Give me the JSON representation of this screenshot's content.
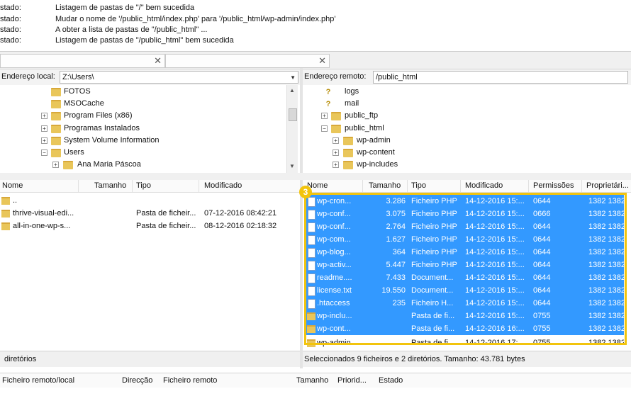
{
  "log": [
    {
      "status": "stado:",
      "message": "Listagem de pastas de \"/\" bem sucedida"
    },
    {
      "status": "stado:",
      "message": "Mudar o nome de '/public_html/index.php' para '/public_html/wp-admin/index.php'"
    },
    {
      "status": "stado:",
      "message": "A obter a lista de pastas de \"/public_html\" ..."
    },
    {
      "status": "stado:",
      "message": "Listagem de pastas de \"/public_html\" bem sucedida"
    }
  ],
  "local": {
    "address_label": "Endereço local:",
    "address_value": "Z:\\Users\\",
    "tree": [
      {
        "label": "FOTOS",
        "expander": ""
      },
      {
        "label": "MSOCache",
        "expander": ""
      },
      {
        "label": "Program Files (x86)",
        "expander": "+"
      },
      {
        "label": "Programas Instalados",
        "expander": "+"
      },
      {
        "label": "System Volume Information",
        "expander": "+"
      },
      {
        "label": "Users",
        "expander": "−"
      },
      {
        "label": "Ana Maria Páscoa",
        "expander": "+"
      }
    ],
    "columns": [
      "Nome",
      "Tamanho",
      "Tipo",
      "Modificado"
    ],
    "files": [
      {
        "name": "..",
        "size": "",
        "type": "",
        "modified": ""
      },
      {
        "name": "thrive-visual-edi...",
        "size": "",
        "type": "Pasta de ficheir...",
        "modified": "07-12-2016 08:42:21"
      },
      {
        "name": "all-in-one-wp-s...",
        "size": "",
        "type": "Pasta de ficheir...",
        "modified": "08-12-2016 02:18:32"
      }
    ],
    "status": "diretórios"
  },
  "remote": {
    "address_label": "Endereço remoto:",
    "address_value": "/public_html",
    "tree": [
      {
        "label": "logs",
        "icon": "unknown"
      },
      {
        "label": "mail",
        "icon": "unknown"
      },
      {
        "label": "public_ftp",
        "icon": "folder",
        "expander": "+"
      },
      {
        "label": "public_html",
        "icon": "folder",
        "expander": "−"
      },
      {
        "label": "wp-admin",
        "icon": "folder",
        "expander": "+"
      },
      {
        "label": "wp-content",
        "icon": "folder",
        "expander": "+"
      },
      {
        "label": "wp-includes",
        "icon": "folder",
        "expander": "+"
      }
    ],
    "columns": [
      "Nome",
      "Tamanho",
      "Tipo",
      "Modificado",
      "Permissões",
      "Proprietári..."
    ],
    "files": [
      {
        "name": "wp-cron...",
        "size": "3.286",
        "type": "Ficheiro PHP",
        "modified": "14-12-2016 15:...",
        "perms": "0644",
        "owner": "1382 1382",
        "kind": "file",
        "selected": true
      },
      {
        "name": "wp-conf...",
        "size": "3.075",
        "type": "Ficheiro PHP",
        "modified": "14-12-2016 15:...",
        "perms": "0666",
        "owner": "1382 1382",
        "kind": "file",
        "selected": true
      },
      {
        "name": "wp-conf...",
        "size": "2.764",
        "type": "Ficheiro PHP",
        "modified": "14-12-2016 15:...",
        "perms": "0644",
        "owner": "1382 1382",
        "kind": "file",
        "selected": true
      },
      {
        "name": "wp-com...",
        "size": "1.627",
        "type": "Ficheiro PHP",
        "modified": "14-12-2016 15:...",
        "perms": "0644",
        "owner": "1382 1382",
        "kind": "file",
        "selected": true
      },
      {
        "name": "wp-blog...",
        "size": "364",
        "type": "Ficheiro PHP",
        "modified": "14-12-2016 15:...",
        "perms": "0644",
        "owner": "1382 1382",
        "kind": "file",
        "selected": true
      },
      {
        "name": "wp-activ...",
        "size": "5.447",
        "type": "Ficheiro PHP",
        "modified": "14-12-2016 15:...",
        "perms": "0644",
        "owner": "1382 1382",
        "kind": "file",
        "selected": true
      },
      {
        "name": "readme....",
        "size": "7.433",
        "type": "Document...",
        "modified": "14-12-2016 15:...",
        "perms": "0644",
        "owner": "1382 1382",
        "kind": "file",
        "selected": true
      },
      {
        "name": "license.txt",
        "size": "19.550",
        "type": "Document...",
        "modified": "14-12-2016 15:...",
        "perms": "0644",
        "owner": "1382 1382",
        "kind": "file",
        "selected": true
      },
      {
        "name": ".htaccess",
        "size": "235",
        "type": "Ficheiro H...",
        "modified": "14-12-2016 15:...",
        "perms": "0644",
        "owner": "1382 1382",
        "kind": "file",
        "selected": true
      },
      {
        "name": "wp-inclu...",
        "size": "",
        "type": "Pasta de fi...",
        "modified": "14-12-2016 15:...",
        "perms": "0755",
        "owner": "1382 1382",
        "kind": "folder",
        "selected": true
      },
      {
        "name": "wp-cont...",
        "size": "",
        "type": "Pasta de fi...",
        "modified": "14-12-2016 16:...",
        "perms": "0755",
        "owner": "1382 1382",
        "kind": "folder",
        "selected": true
      },
      {
        "name": "wp-admin",
        "size": "",
        "type": "Pasta de fi...",
        "modified": "14-12-2016 17:...",
        "perms": "0755",
        "owner": "1382 1382",
        "kind": "folder",
        "selected": false
      }
    ],
    "status": "Seleccionados 9 ficheiros e 2 diretórios. Tamanho: 43.781 bytes"
  },
  "queue": {
    "columns": [
      "Ficheiro remoto/local",
      "Direcção",
      "Ficheiro remoto",
      "Tamanho",
      "Priorid...",
      "Estado"
    ]
  },
  "annotation": {
    "badge": "3",
    "color": "#f2c40d"
  },
  "colors": {
    "selection": "#3399ff",
    "folder": "#e9c65a"
  }
}
